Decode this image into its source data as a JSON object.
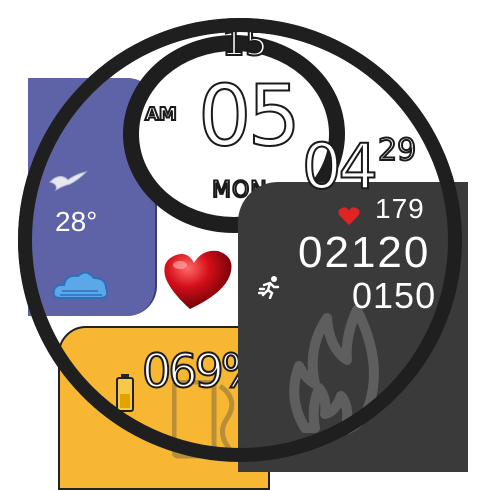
{
  "time": {
    "date_day": "15",
    "ampm": "AM",
    "hour": "05",
    "weekday": "MON",
    "minute": "04",
    "second": "29"
  },
  "weather": {
    "temperature": "28°",
    "condition_icon": "cloud-icon",
    "bird_icon": "bird-icon"
  },
  "battery": {
    "percent": "069%",
    "icon": "battery-icon"
  },
  "activity": {
    "heart_rate": "179",
    "steps": "02120",
    "calories": "0150",
    "icons": [
      "heart-icon",
      "run-icon",
      "flame-icon"
    ]
  },
  "colors": {
    "weather_panel": "#5e63a8",
    "battery_panel": "#f7b733",
    "activity_panel": "#3a3a3a",
    "bezel": "#1f1f1f",
    "heart": "#e02424"
  }
}
